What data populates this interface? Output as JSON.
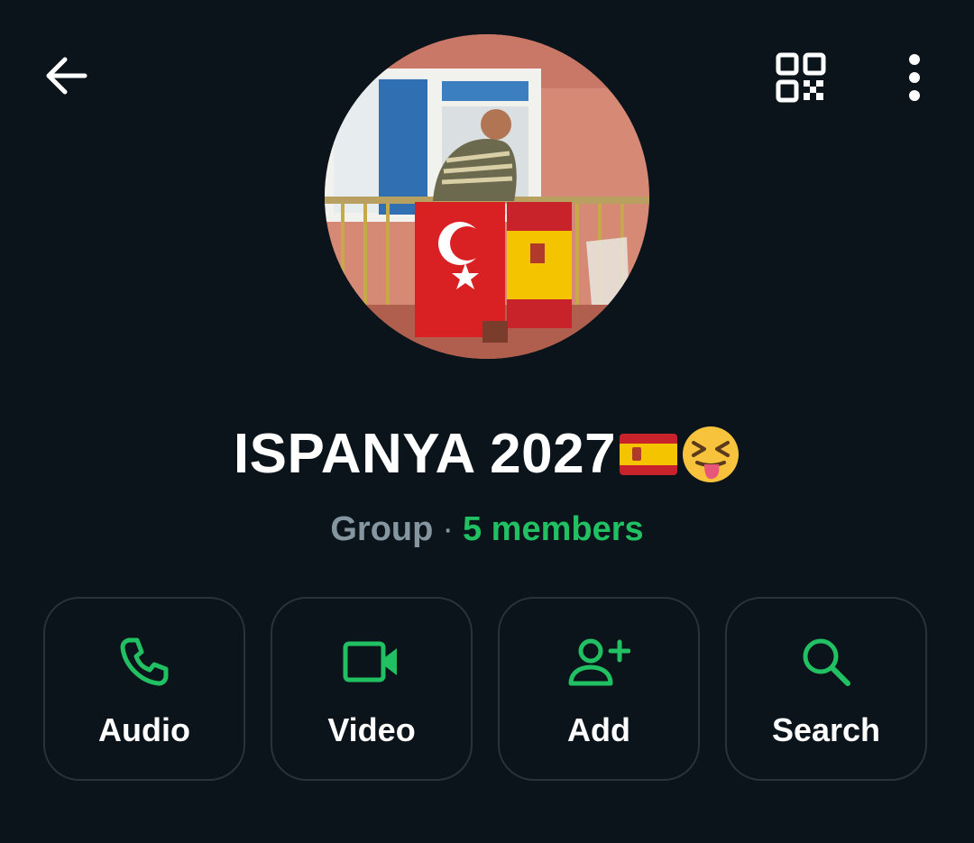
{
  "header": {
    "back_icon": "arrow-left-icon",
    "qr_icon": "qr-code-icon",
    "menu_icon": "more-vertical-icon"
  },
  "profile": {
    "group_name": "ISPANYA 2027",
    "name_emojis": [
      "spain-flag-emoji",
      "squinting-tongue-emoji"
    ],
    "kind": "Group",
    "separator": "·",
    "members": "5 members"
  },
  "actions": [
    {
      "label": "Audio",
      "icon": "phone-icon"
    },
    {
      "label": "Video",
      "icon": "video-camera-icon"
    },
    {
      "label": "Add",
      "icon": "add-person-icon"
    },
    {
      "label": "Search",
      "icon": "search-icon"
    }
  ],
  "colors": {
    "background": "#0b141a",
    "accent": "#21c063",
    "muted": "#8696a0",
    "border": "#2a3339"
  }
}
